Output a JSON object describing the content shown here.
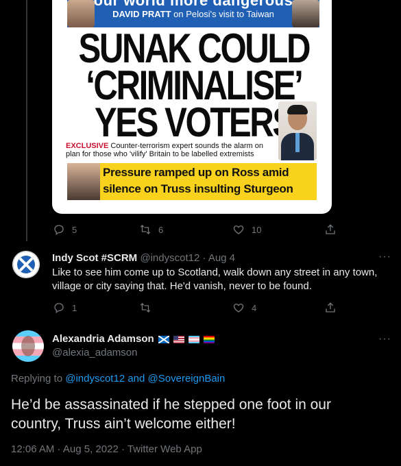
{
  "newspaper": {
    "banner_head": "our world more dangerous",
    "banner_author": "DAVID PRATT",
    "banner_sub": "on Pelosi's visit to Taiwan",
    "headline": [
      "SUNAK COULD",
      "‘CRIMINALISE’",
      "YES VOTERS"
    ],
    "exclusive_tag": "EXCLUSIVE",
    "exclusive_text": "Counter-terrorism expert sounds the alarm on plan for those who 'vilify' Britain to be labelled extremists",
    "yellow_line1": "Pressure ramped up on Ross amid",
    "yellow_line2": "silence on Truss insulting Sturgeon"
  },
  "tweet1_actions": {
    "replies": "5",
    "retweets": "6",
    "likes": "10"
  },
  "reply1": {
    "name": "Indy Scot #SCRM",
    "handle": "@indyscot12",
    "date": "· Aug 4",
    "text": "Like to see him come up to Scotland, walk down any street in any town, village or city saying that. He'd vanish, never to be found.",
    "replies": "1",
    "retweets": "",
    "likes": "4",
    "more": "···"
  },
  "main_tweet": {
    "name": "Alexandria Adamson",
    "handle": "@alexia_adamson",
    "more": "···",
    "replying_prefix": "Replying to",
    "replying_to1": "@indyscot12",
    "replying_and": "and",
    "replying_to2": "@SovereignBain",
    "text": "He’d be assassinated if he stepped one foot in our country, Truss ain’t welcome either!",
    "meta": "12:06 AM · Aug 5, 2022 · Twitter Web App"
  },
  "colors": {
    "accent": "#1d9bf0",
    "muted": "#71767b",
    "text": "#e7e9ea",
    "background": "#000000"
  }
}
